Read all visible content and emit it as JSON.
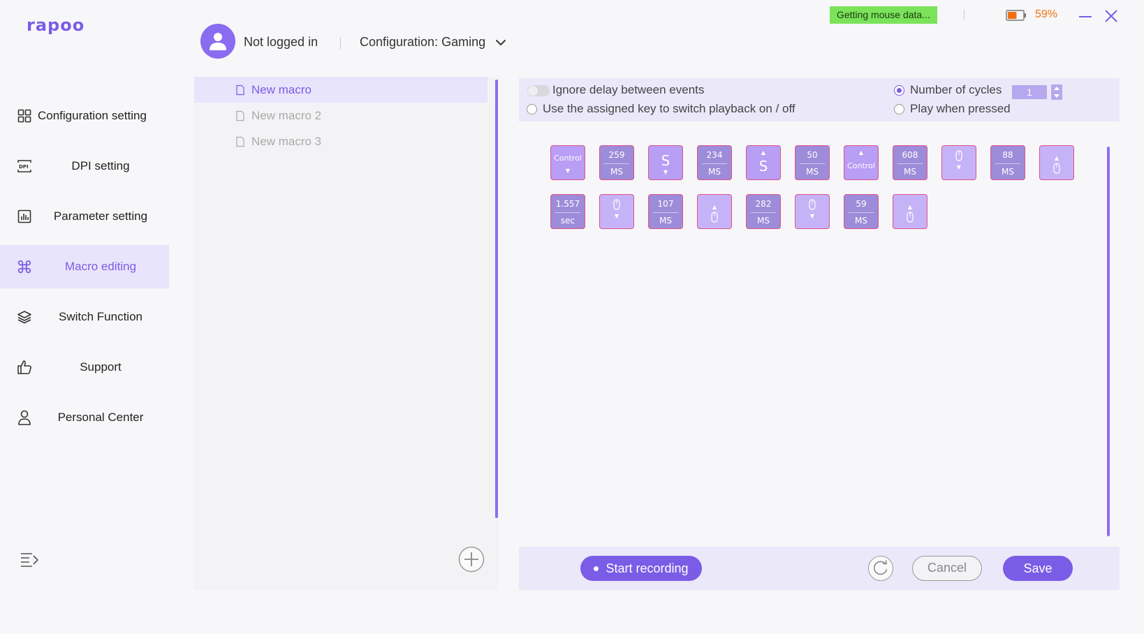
{
  "app": {
    "brand": "rapoo",
    "accent_color": "#7b5ce6",
    "status_badge": "Getting mouse data...",
    "battery_percent": "59%",
    "battery_level": 0.59
  },
  "header": {
    "login_status": "Not logged in",
    "configuration": "Configuration: Gaming"
  },
  "sidebar": {
    "items": [
      {
        "label": "Configuration setting",
        "icon": "grid-icon"
      },
      {
        "label": "DPI setting",
        "icon": "dpi-icon"
      },
      {
        "label": "Parameter setting",
        "icon": "bar-chart-icon"
      },
      {
        "label": "Macro editing",
        "icon": "command-icon",
        "active": true
      },
      {
        "label": "Switch Function",
        "icon": "layers-icon"
      },
      {
        "label": "Support",
        "icon": "thumbs-up-icon"
      },
      {
        "label": "Personal Center",
        "icon": "user-icon"
      }
    ]
  },
  "macros": {
    "items": [
      {
        "label": "New macro",
        "active": true
      },
      {
        "label": "New macro 2"
      },
      {
        "label": "New macro 3"
      }
    ]
  },
  "options": {
    "ignore_delay_label": "Ignore delay between events",
    "ignore_delay_on": false,
    "assigned_key_label": "Use the assigned key to switch playback on / off",
    "cycles_label": "Number of cycles",
    "cycles_value": "1",
    "play_when_pressed_label": "Play when pressed",
    "selected_mode": "Number of cycles"
  },
  "events": {
    "row1": [
      {
        "type": "key-down",
        "label": "Control"
      },
      {
        "type": "delay",
        "value": "259",
        "unit": "MS"
      },
      {
        "type": "key-down",
        "label": "S"
      },
      {
        "type": "delay",
        "value": "234",
        "unit": "MS"
      },
      {
        "type": "key-up",
        "label": "S"
      },
      {
        "type": "delay",
        "value": "50",
        "unit": "MS"
      },
      {
        "type": "key-up",
        "label": "Control"
      },
      {
        "type": "delay",
        "value": "608",
        "unit": "MS"
      },
      {
        "type": "mouse-down"
      },
      {
        "type": "delay",
        "value": "88",
        "unit": "MS"
      },
      {
        "type": "mouse-up"
      }
    ],
    "row2": [
      {
        "type": "delay",
        "value": "1.557",
        "unit": "sec"
      },
      {
        "type": "mouse-down"
      },
      {
        "type": "delay",
        "value": "107",
        "unit": "MS"
      },
      {
        "type": "mouse-up"
      },
      {
        "type": "delay",
        "value": "282",
        "unit": "MS"
      },
      {
        "type": "mouse-down"
      },
      {
        "type": "delay",
        "value": "59",
        "unit": "MS"
      },
      {
        "type": "mouse-up"
      }
    ]
  },
  "bottom": {
    "record_label": "Start recording",
    "cancel_label": "Cancel",
    "save_label": "Save"
  }
}
